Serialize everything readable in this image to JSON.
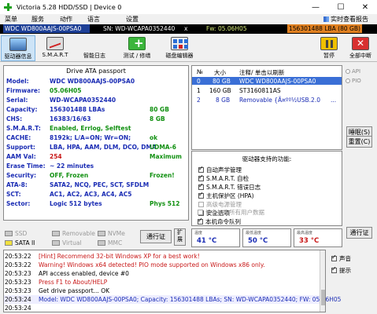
{
  "window": {
    "title": "Victoria 5.28 HDD/SSD | Device 0",
    "minimize": "—",
    "maximize": "☐",
    "close": "✕"
  },
  "menu": {
    "items": [
      "菜单",
      "服务",
      "动作",
      "语言",
      "设置"
    ],
    "right": "实时查看报告"
  },
  "drive_bar": {
    "model": "WDC WD800AAJS-00PSA0",
    "sn": "SN: WD-WCAPA0352440",
    "close": "x",
    "fw": "Fw: 05.06H05",
    "lba": "156301488 LBA (80 GB)"
  },
  "toolbar": {
    "buttons": [
      "驱动器信息",
      "S.M.A.R.T",
      "智能日志",
      "测试 / 修缮",
      "磁盘编辑器",
      "暂停",
      "全部中断"
    ]
  },
  "passport": {
    "title": "Drive ATA passport",
    "rows": [
      {
        "label": "Model:",
        "value": "WDC WD800AAJS-00PSA0",
        "right": ""
      },
      {
        "label": "Firmware:",
        "value": "05.06H05",
        "right": ""
      },
      {
        "label": "Serial:",
        "value": "WD-WCAPA0352440",
        "right": ""
      },
      {
        "label": "Capacity:",
        "value": "156301488 LBAs",
        "right": "80 GB"
      },
      {
        "label": "CHS:",
        "value": "16383/16/63",
        "right": "8 GB"
      },
      {
        "label": "S.M.A.R.T:",
        "value": "Enabled, Errlog, Selftest",
        "right": ""
      },
      {
        "label": "CACHE:",
        "value": "8192k; L/A=ON; Wr=ON;",
        "right": "ok"
      },
      {
        "label": "Support:",
        "value": "LBA, HPA, AAM, DLM, DCO, DMA",
        "right": "UDMA-6"
      },
      {
        "label": "AAM Val:",
        "value": "254",
        "right": "Maximum"
      },
      {
        "label": "Erase Time:",
        "value": "~ 22 minutes",
        "right": ""
      },
      {
        "label": "Security:",
        "value": "OFF, Frozen",
        "right": "Frozen!"
      },
      {
        "label": "ATA-8:",
        "value": "SATA2, NCQ, PEC, SCT, SFDLM",
        "right": ""
      },
      {
        "label": "SCT:",
        "value": "AC1, AC2, AC3, AC4, AC5",
        "right": ""
      },
      {
        "label": "Sector:",
        "value": "Logic 512 bytes",
        "right": "Phys 512"
      }
    ]
  },
  "drives": {
    "headers": {
      "num": "№",
      "size": "大小",
      "note": "注释/ 单击以刷新"
    },
    "rows": [
      {
        "num": "0",
        "size": "80 GB",
        "name": "WDC WD800AAJS-00PSA0",
        "extra": ""
      },
      {
        "num": "1",
        "size": "160 GB",
        "name": "ST3160811AS",
        "extra": ""
      },
      {
        "num": "2",
        "size": "8 GB",
        "name": "Removable {Ã¤ºº½USB.2.0",
        "extra": "..."
      }
    ]
  },
  "right_panel": {
    "api": "API",
    "pio": "PIO",
    "sleep": "睡眠(S)",
    "reset": "重置(C)",
    "passport": "通行证"
  },
  "features": {
    "title": "驱动器支持的功能:",
    "items": [
      {
        "label": "自动声学管理",
        "checked": true,
        "enabled": true
      },
      {
        "label": "S.M.A.R.T. 自检",
        "checked": true,
        "enabled": true
      },
      {
        "label": "S.M.A.R.T. 错误日志",
        "checked": true,
        "enabled": true
      },
      {
        "label": "主机保护区 (HPA)",
        "checked": true,
        "enabled": true
      },
      {
        "label": "高级电源管理",
        "checked": false,
        "enabled": false
      },
      {
        "label": "安全选项",
        "checked": true,
        "enabled": true
      },
      {
        "label": "设备加密所有用户数据",
        "checked": false,
        "enabled": false
      },
      {
        "label": "本机命令队列",
        "checked": true,
        "enabled": true
      }
    ]
  },
  "legend": {
    "items": [
      {
        "label": "SSD",
        "color": "#c8c8c8"
      },
      {
        "label": "Removable",
        "color": "#c8c8c8"
      },
      {
        "label": "NVMe",
        "color": "#c8c8c8"
      },
      {
        "label": "SATA II",
        "color": "#f0e040"
      },
      {
        "label": "Virtual",
        "color": "#c8c8c8"
      },
      {
        "label": "MMC",
        "color": "#c8c8c8"
      }
    ],
    "passport_button": "通行证",
    "ext_button": "扩展"
  },
  "temps": [
    {
      "label": "温度",
      "value": "41 °C",
      "alert": false
    },
    {
      "label": "最低温度",
      "value": "50 °C",
      "alert": false
    },
    {
      "label": "最高温度",
      "value": "33 °C",
      "alert": true
    }
  ],
  "log": {
    "lines": [
      {
        "time": "20:53:22",
        "text": "[Hint] Recommend 32-bit Windows XP for a best work!",
        "style": "red"
      },
      {
        "time": "20:53:22",
        "text": "Warning! Windows x64 detected! PIO mode supported on Windows x86 only.",
        "style": "red"
      },
      {
        "time": "20:53:23",
        "text": "API access enabled, device #0",
        "style": ""
      },
      {
        "time": "20:53:23",
        "text": "Press F1 to About/HELP",
        "style": "red"
      },
      {
        "time": "20:53:23",
        "text": "Get drive passport... OK",
        "style": ""
      },
      {
        "time": "20:53:24",
        "text": "Model: WDC WD800AAJS-00PSA0; Capacity: 156301488 LBAs; SN: WD-WCAPA0352440; FW: 05.06H05",
        "style": "blue"
      },
      {
        "time": "20:53:24",
        "text": "",
        "style": ""
      }
    ],
    "sound": "声音",
    "hints": "提示"
  }
}
